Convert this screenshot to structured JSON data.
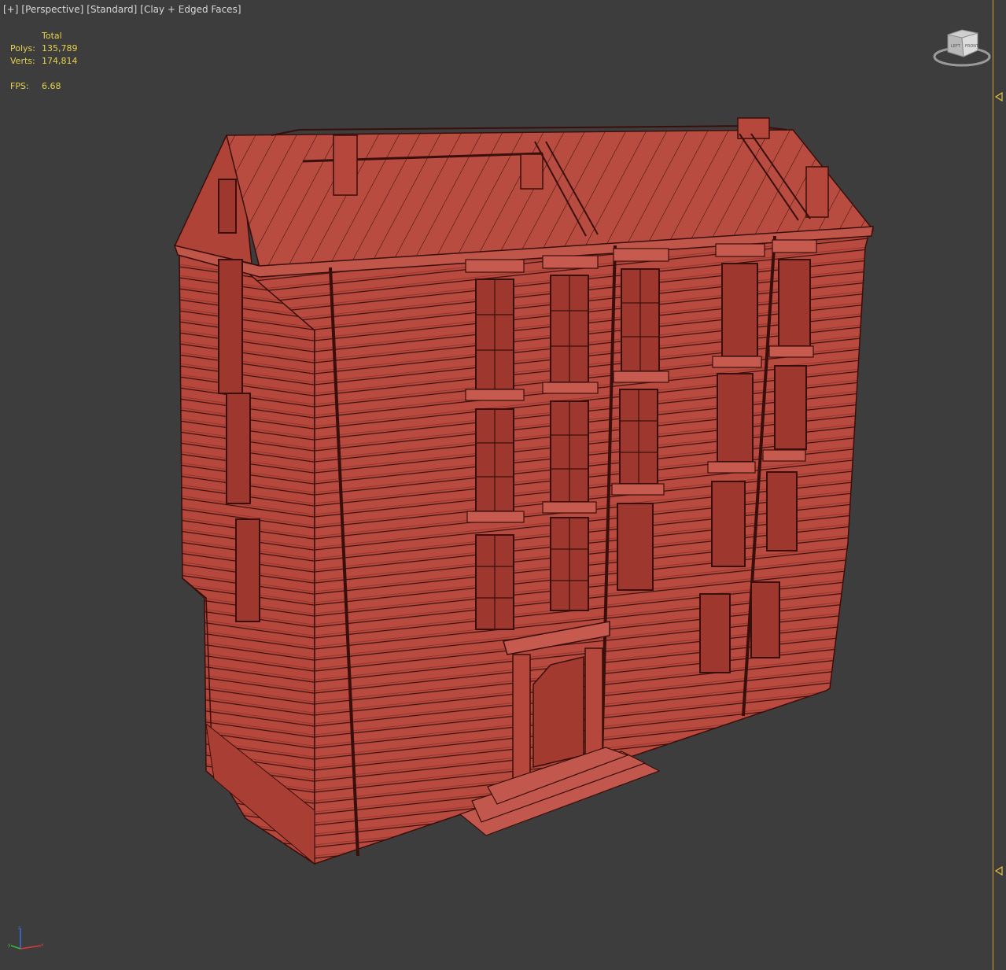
{
  "viewport": {
    "labels": [
      "[+]",
      "[Perspective]",
      "[Standard]",
      "[Clay + Edged Faces]"
    ]
  },
  "stats": {
    "header": "Total",
    "polys_label": "Polys:",
    "polys_value": "135,789",
    "verts_label": "Verts:",
    "verts_value": "174,814",
    "fps_label": "FPS:",
    "fps_value": "6.68"
  },
  "viewcube": {
    "face_left": "LEFT",
    "face_front": "FRONT"
  },
  "colors": {
    "background": "#3d3d3d",
    "model_fill": "#b5473c",
    "model_edge": "#3a0f0b",
    "stats_text": "#e6d24a",
    "label_text": "#d8d8d8"
  },
  "icons": {
    "viewcube": "viewcube-icon",
    "axis_tripod": "axis-tripod-icon",
    "time_marker": "triangle-marker-icon"
  }
}
